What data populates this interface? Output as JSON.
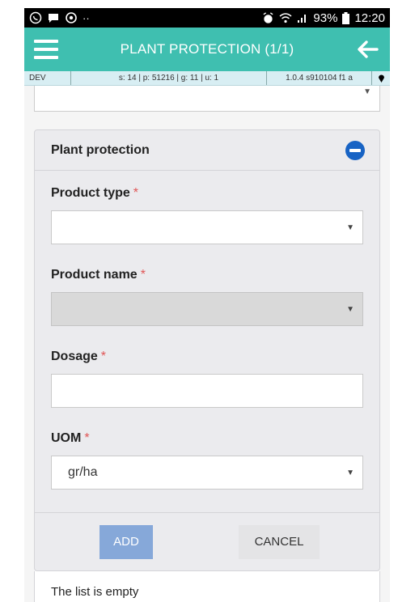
{
  "status_bar": {
    "battery": "93%",
    "time": "12:20",
    "icons": [
      "whatsapp-icon",
      "message-icon",
      "sync-icon",
      "more-dots-icon",
      "alarm-icon",
      "wifi-icon",
      "signal-icon",
      "battery-icon"
    ]
  },
  "app_bar": {
    "title": "PLANT PROTECTION (1/1)",
    "background": "#3fbfb0",
    "icons": [
      "menu-icon",
      "back-arrow-icon"
    ]
  },
  "dev_bar": {
    "env": "DEV",
    "stats": "s: 14 | p: 51216 | g: 11 | u: 1",
    "version": "1.0.4 s910104 f1 a"
  },
  "panel": {
    "title": "Plant protection",
    "fields": {
      "product_type": {
        "label": "Product type",
        "value": ""
      },
      "product_name": {
        "label": "Product name",
        "value": ""
      },
      "dosage": {
        "label": "Dosage",
        "value": ""
      },
      "uom": {
        "label": "UOM",
        "value": "gr/ha"
      }
    },
    "required_mark": "*",
    "add_label": "ADD",
    "cancel_label": "CANCEL"
  },
  "list": {
    "empty_text": "The list is empty"
  },
  "colors": {
    "accent": "#3fbfb0",
    "primary_button": "#86a8d9",
    "collapse_icon": "#1863c4",
    "required": "#e05555"
  }
}
